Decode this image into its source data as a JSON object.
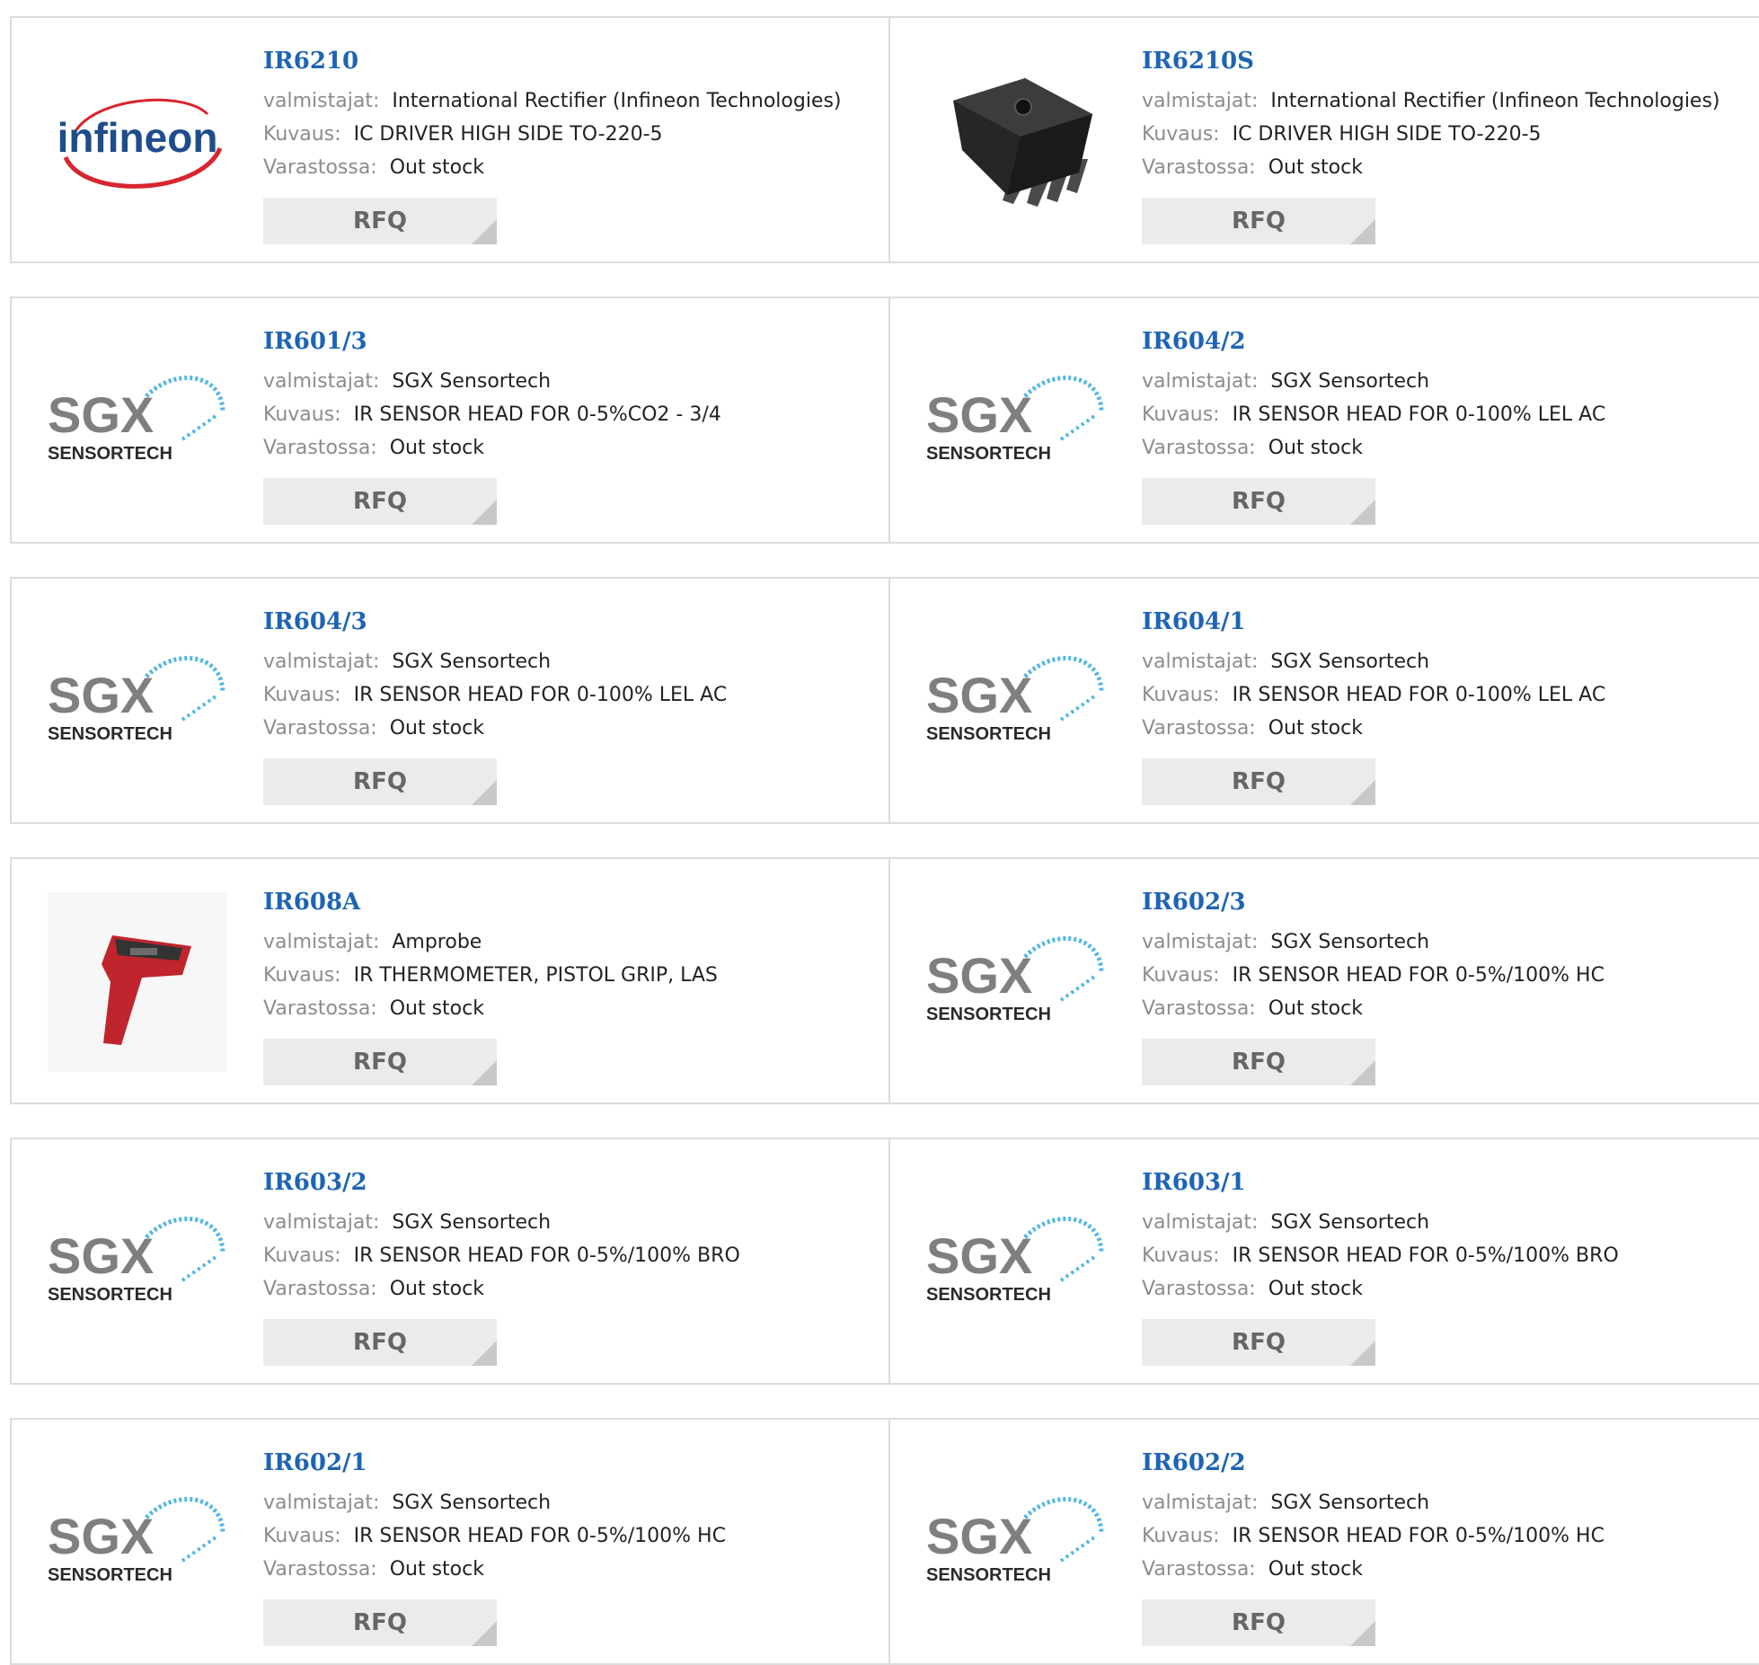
{
  "labels": {
    "manufacturer": "valmistajat:",
    "description": "Kuvaus:",
    "stock": "Varastossa:",
    "rfq": "RFQ"
  },
  "logo_text": {
    "infineon": "infineon",
    "sgx": "SGX",
    "sensortech": "SENSORTECH"
  },
  "products": [
    {
      "part": "IR6210",
      "manufacturer": "International Rectifier (Infineon Technologies)",
      "description": "IC DRIVER HIGH SIDE TO-220-5",
      "stock": "Out stock",
      "image": "infineon-logo"
    },
    {
      "part": "IR6210S",
      "manufacturer": "International Rectifier (Infineon Technologies)",
      "description": "IC DRIVER HIGH SIDE TO-220-5",
      "stock": "Out stock",
      "image": "to220-chip"
    },
    {
      "part": "IR601/3",
      "manufacturer": "SGX Sensortech",
      "description": "IR SENSOR HEAD FOR 0-5%CO2 - 3/4",
      "stock": "Out stock",
      "image": "sgx-logo"
    },
    {
      "part": "IR604/2",
      "manufacturer": "SGX Sensortech",
      "description": "IR SENSOR HEAD FOR 0-100% LEL AC",
      "stock": "Out stock",
      "image": "sgx-logo"
    },
    {
      "part": "IR604/3",
      "manufacturer": "SGX Sensortech",
      "description": "IR SENSOR HEAD FOR 0-100% LEL AC",
      "stock": "Out stock",
      "image": "sgx-logo"
    },
    {
      "part": "IR604/1",
      "manufacturer": "SGX Sensortech",
      "description": "IR SENSOR HEAD FOR 0-100% LEL AC",
      "stock": "Out stock",
      "image": "sgx-logo"
    },
    {
      "part": "IR608A",
      "manufacturer": "Amprobe",
      "description": "IR THERMOMETER, PISTOL GRIP, LAS",
      "stock": "Out stock",
      "image": "ir-thermometer"
    },
    {
      "part": "IR602/3",
      "manufacturer": "SGX Sensortech",
      "description": "IR SENSOR HEAD FOR 0-5%/100% HC",
      "stock": "Out stock",
      "image": "sgx-logo"
    },
    {
      "part": "IR603/2",
      "manufacturer": "SGX Sensortech",
      "description": "IR SENSOR HEAD FOR 0-5%/100% BRO",
      "stock": "Out stock",
      "image": "sgx-logo"
    },
    {
      "part": "IR603/1",
      "manufacturer": "SGX Sensortech",
      "description": "IR SENSOR HEAD FOR 0-5%/100% BRO",
      "stock": "Out stock",
      "image": "sgx-logo"
    },
    {
      "part": "IR602/1",
      "manufacturer": "SGX Sensortech",
      "description": "IR SENSOR HEAD FOR 0-5%/100% HC",
      "stock": "Out stock",
      "image": "sgx-logo"
    },
    {
      "part": "IR602/2",
      "manufacturer": "SGX Sensortech",
      "description": "IR SENSOR HEAD FOR 0-5%/100% HC",
      "stock": "Out stock",
      "image": "sgx-logo"
    }
  ],
  "colors": {
    "part_link": "#1e64b4",
    "label": "#8c8c8c",
    "value": "#222222",
    "border": "#dcdcdc",
    "rfq_bg": "#ebebeb",
    "infineon_red": "#d7242f",
    "infineon_blue": "#1e4d8c",
    "sgx_grey": "#7f7f7f",
    "sgx_blue": "#4eb6e6",
    "thermometer_red": "#c0242c"
  }
}
